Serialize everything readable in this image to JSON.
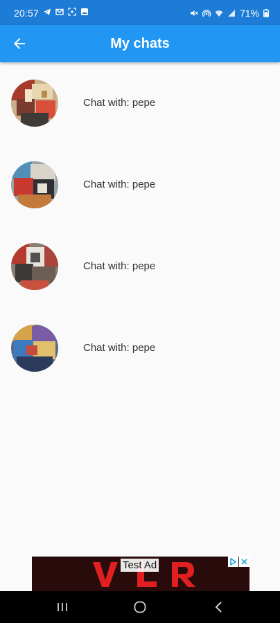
{
  "status_bar": {
    "time": "20:57",
    "battery": "71%",
    "left_icons": [
      "telegram-icon",
      "gmail-icon",
      "screenshot-icon",
      "gallery-icon"
    ],
    "right_icons": [
      "mute-icon",
      "hotspot-icon",
      "wifi-icon",
      "signal-icon",
      "battery-icon"
    ]
  },
  "app_bar": {
    "title": "My chats",
    "back_icon": "arrow-left-icon",
    "background_color": "#2196f3"
  },
  "chats": [
    {
      "label": "Chat with: pepe",
      "avatar_icon": "collage-avatar"
    },
    {
      "label": "Chat with: pepe",
      "avatar_icon": "collage-avatar"
    },
    {
      "label": "Chat with: pepe",
      "avatar_icon": "collage-avatar"
    },
    {
      "label": "Chat with: pepe",
      "avatar_icon": "collage-avatar"
    }
  ],
  "ad": {
    "label": "Test Ad",
    "logo_text": "VLR",
    "logo_color": "#e02020"
  },
  "nav_bar": {
    "buttons": [
      "recents-icon",
      "home-icon",
      "back-icon"
    ]
  }
}
